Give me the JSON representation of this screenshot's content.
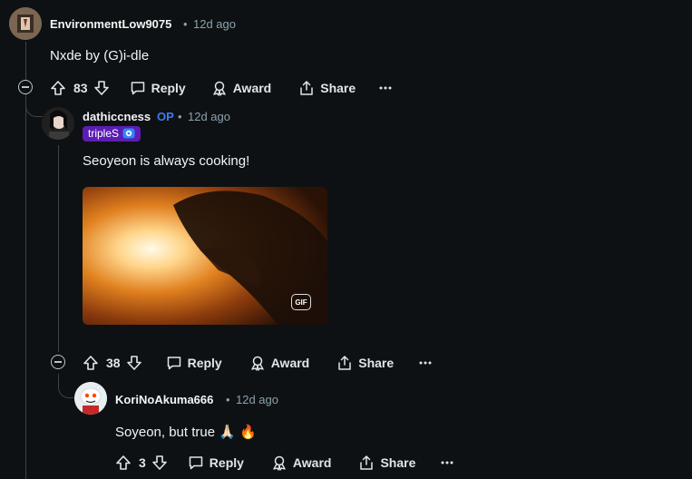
{
  "comments": [
    {
      "username": "EnvironmentLow9075",
      "time": "12d ago",
      "text": "Nxde by (G)i-dle",
      "votes": "83",
      "actions": {
        "reply": "Reply",
        "award": "Award",
        "share": "Share"
      }
    },
    {
      "username": "dathiccness",
      "op_badge": "OP",
      "time": "12d ago",
      "flair": "tripleS",
      "text": "Seoyeon is always cooking!",
      "gif_badge": "GIF",
      "votes": "38",
      "actions": {
        "reply": "Reply",
        "award": "Award",
        "share": "Share"
      }
    },
    {
      "username": "KoriNoAkuma666",
      "time": "12d ago",
      "text": "Soyeon, but true 🙏🏻 🔥",
      "votes": "3",
      "actions": {
        "reply": "Reply",
        "award": "Award",
        "share": "Share"
      }
    }
  ],
  "separator": "•"
}
